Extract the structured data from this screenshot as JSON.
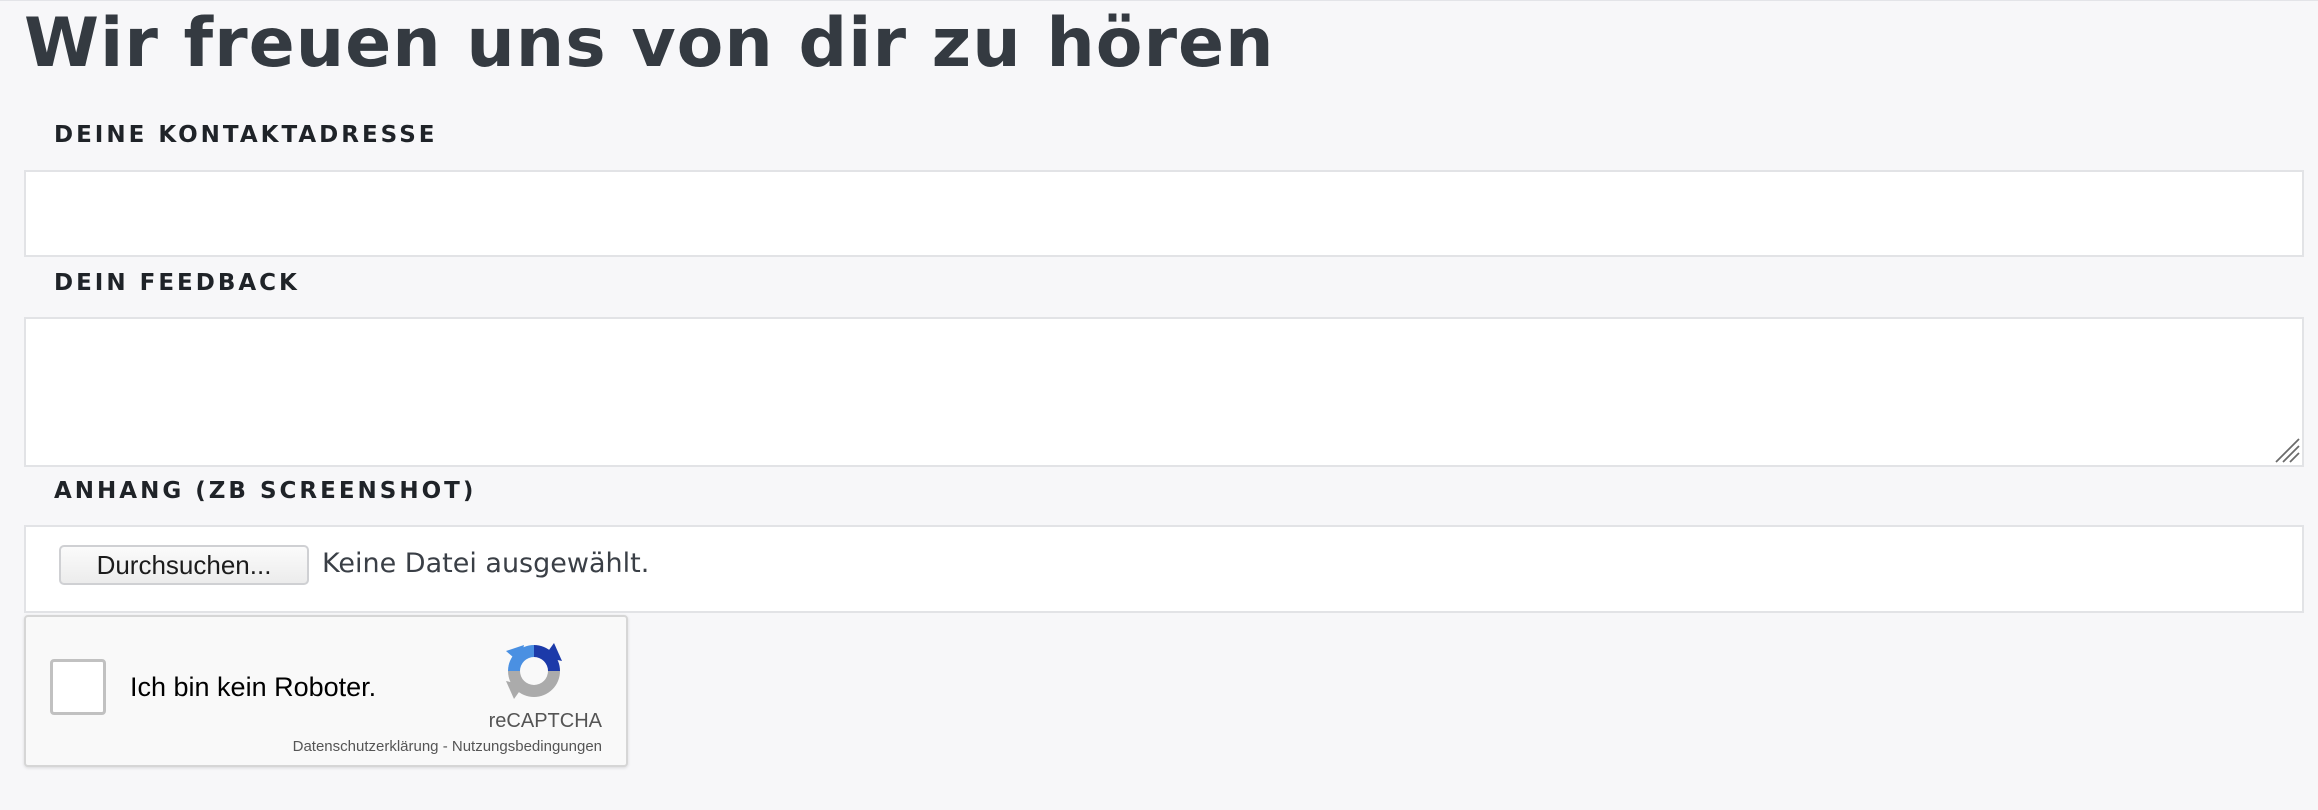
{
  "page": {
    "title": "Wir freuen uns von dir zu hören"
  },
  "form": {
    "contact_label": "DEINE KONTAKTADRESSE",
    "contact_value": "",
    "feedback_label": "DEIN FEEDBACK",
    "feedback_value": "",
    "attachment_label": "ANHANG (ZB SCREENSHOT)",
    "browse_button": "Durchsuchen...",
    "file_status": "Keine Datei ausgewählt."
  },
  "recaptcha": {
    "checkbox_label": "Ich bin kein Roboter.",
    "checked": false,
    "brand": "reCAPTCHA",
    "privacy_link": "Datenschutzerklärung",
    "separator": " - ",
    "terms_link": "Nutzungsbedingungen"
  },
  "colors": {
    "background": "#f7f7f9",
    "field_border": "#e2e3e6",
    "title_text": "#343a41",
    "recaptcha_blue": "#4a90e2",
    "recaptcha_dark_blue": "#1c3aa9",
    "recaptcha_gray": "#ababab"
  },
  "icons": {
    "recaptcha_logo": "recaptcha-logo-icon",
    "resize_handle": "resize-grip-icon"
  }
}
